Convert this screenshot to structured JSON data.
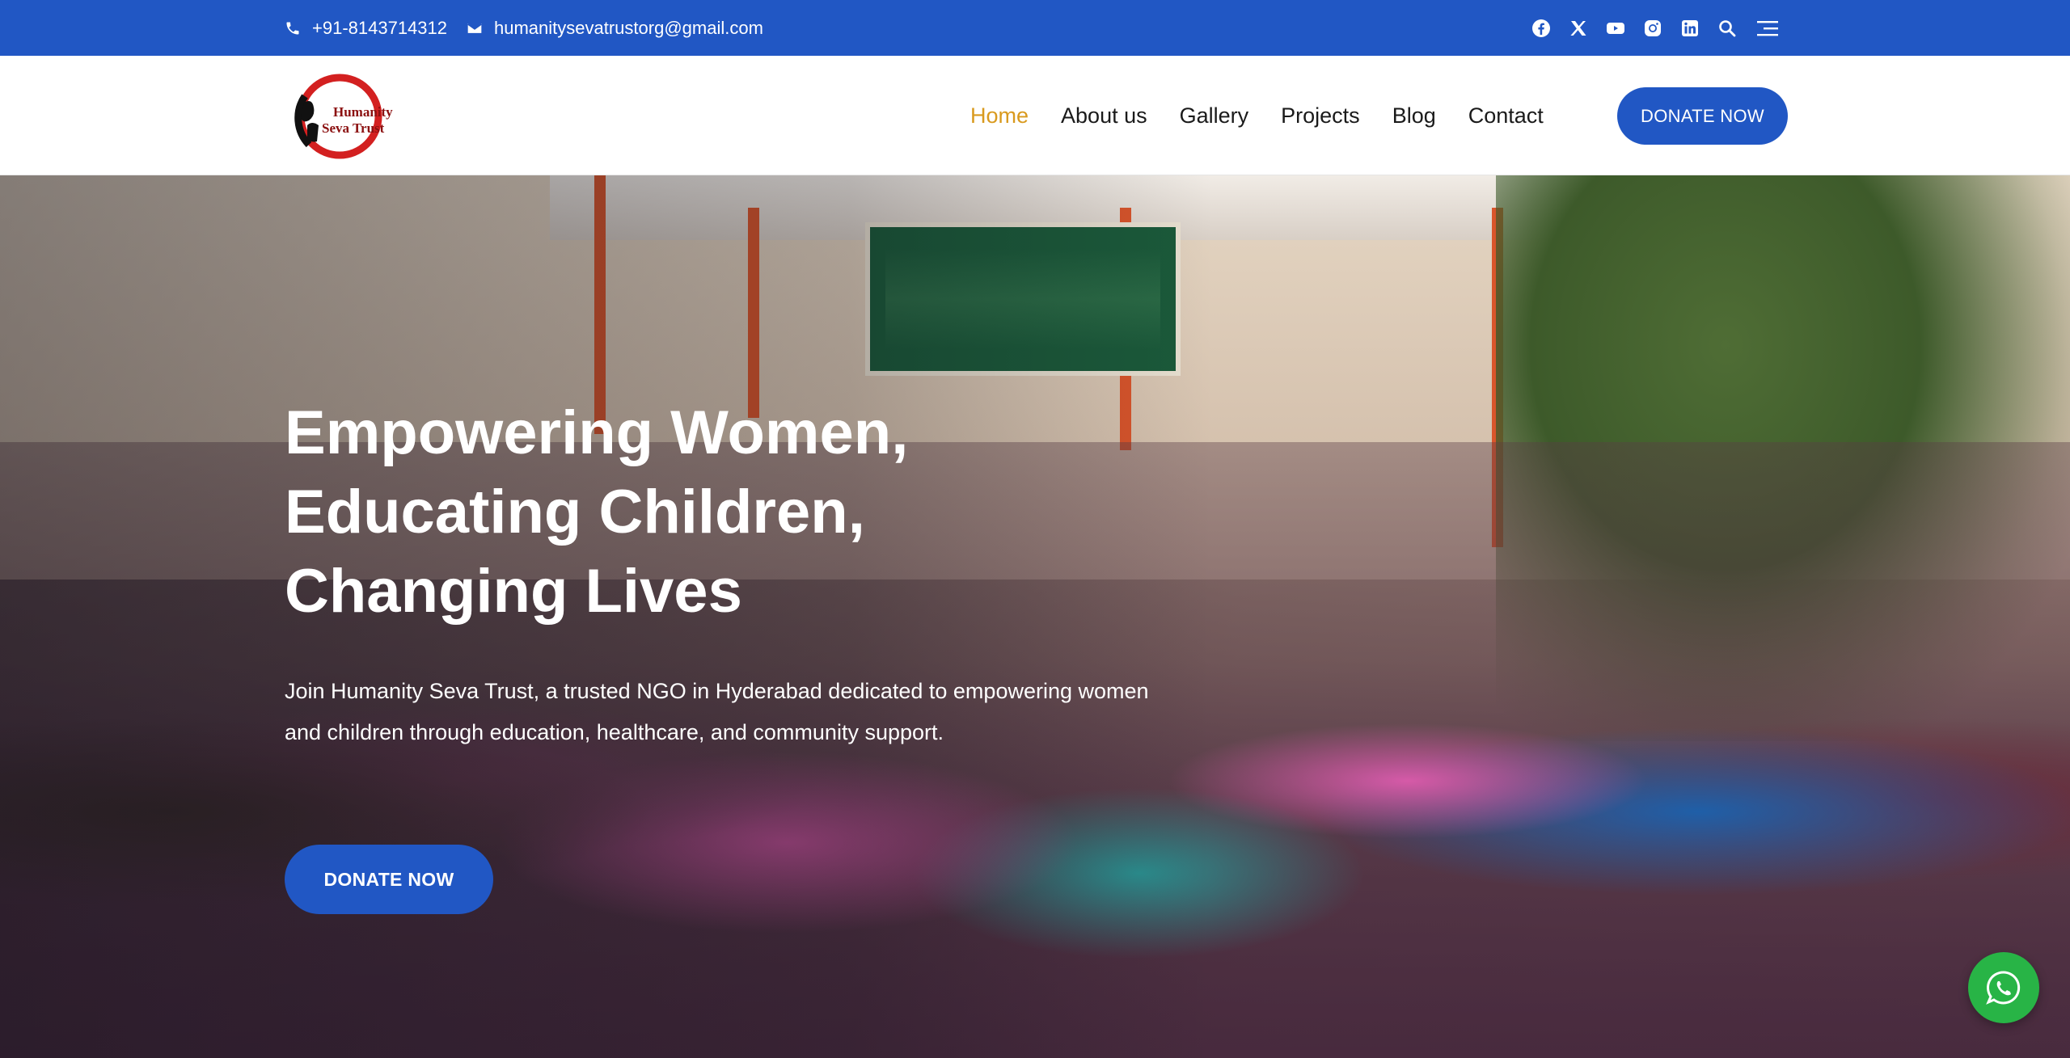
{
  "topbar": {
    "phone": "+91-8143714312",
    "email": "humanitysevatrustorg@gmail.com",
    "icons": [
      "phone-icon",
      "envelope-icon",
      "facebook-icon",
      "x-icon",
      "youtube-icon",
      "instagram-icon",
      "linkedin-icon",
      "search-icon",
      "menu-icon"
    ]
  },
  "header": {
    "logo_line1": "Humanity",
    "logo_line2": "Seva Trust",
    "nav": [
      {
        "label": "Home",
        "active": true
      },
      {
        "label": "About us",
        "active": false
      },
      {
        "label": "Gallery",
        "active": false
      },
      {
        "label": "Projects",
        "active": false
      },
      {
        "label": "Blog",
        "active": false
      },
      {
        "label": "Contact",
        "active": false
      }
    ],
    "donate_label": "DONATE NOW"
  },
  "hero": {
    "title_lines": [
      "Empowering Women,",
      "Educating Children,",
      "Changing Lives"
    ],
    "description": "Join Humanity Seva Trust, a trusted NGO in Hyderabad dedicated to empowering women and children through education, healthcare, and community support.",
    "donate_label": "DONATE NOW"
  },
  "colors": {
    "primary": "#2157c4",
    "nav_active": "#d99a1e",
    "whatsapp": "#28b446",
    "logo_red": "#d32020"
  }
}
